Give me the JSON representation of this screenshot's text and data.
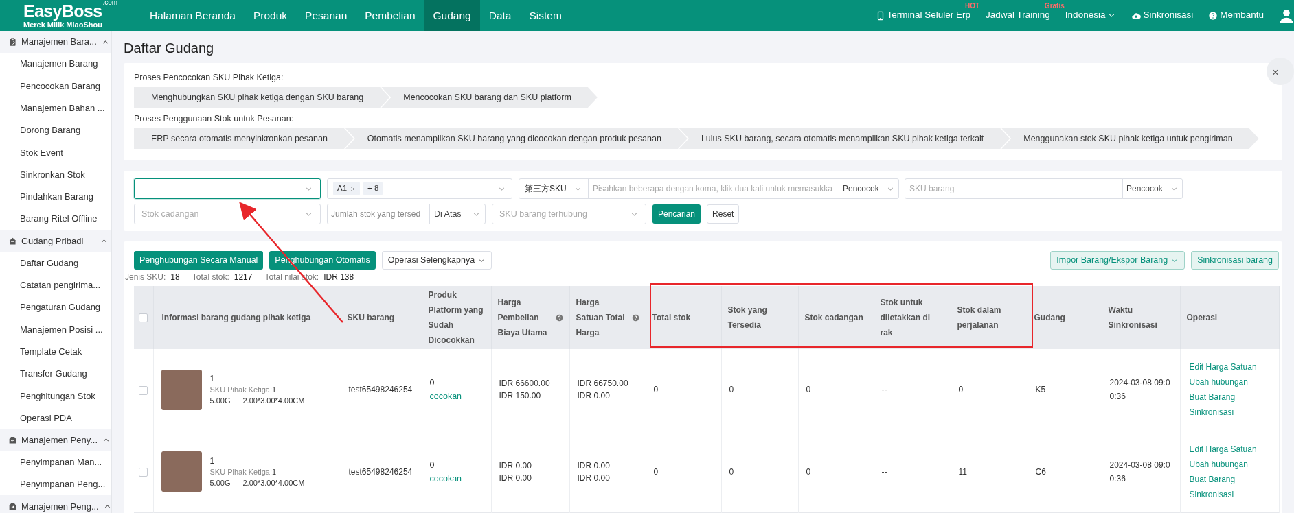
{
  "header": {
    "logo": {
      "title": "EasyBoss",
      "suffix": ".com",
      "subtitle": "Merek Milik MiaoShou"
    },
    "nav": [
      {
        "label": "Halaman Beranda",
        "selected": false
      },
      {
        "label": "Produk",
        "selected": false
      },
      {
        "label": "Pesanan",
        "selected": false
      },
      {
        "label": "Pembelian",
        "selected": false
      },
      {
        "label": "Gudang",
        "selected": true
      },
      {
        "label": "Data",
        "selected": false
      },
      {
        "label": "Sistem",
        "selected": false
      }
    ],
    "tools": [
      {
        "kind": "phone",
        "label": "Terminal Seluler Erp",
        "badge": "HOT"
      },
      {
        "kind": "plain",
        "label": "Jadwal Training",
        "badge": "Gratis"
      },
      {
        "kind": "dropdown",
        "label": "Indonesia"
      },
      {
        "kind": "cloud",
        "label": "Sinkronisasi"
      },
      {
        "kind": "help",
        "label": "Membantu"
      },
      {
        "kind": "user"
      }
    ]
  },
  "sidebar": {
    "groups": [
      {
        "kind": "clipboard",
        "label": "Manajemen Bara...",
        "expanded": true,
        "items": [
          "Manajemen Barang",
          "Pencocokan Barang",
          "Manajemen Bahan ...",
          "Dorong Barang",
          "Stok Event",
          "Sinkronkan Stok",
          "Pindahkan Barang",
          "Barang Ritel Offline"
        ]
      },
      {
        "kind": "house",
        "label": "Gudang Pribadi",
        "expanded": true,
        "items": [
          "Daftar Gudang",
          "Catatan pengirima...",
          "Pengaturan Gudang",
          "Manajemen Posisi ...",
          "Template Cetak",
          "Transfer Gudang",
          "Penghitungan Stok",
          "Operasi PDA"
        ]
      },
      {
        "kind": "inbox",
        "label": "Manajemen Peny...",
        "expanded": true,
        "items": [
          "Penyimpanan Man...",
          "Penyimpanan Peng..."
        ]
      },
      {
        "kind": "outbox",
        "label": "Manajemen Peng...",
        "expanded": true
      }
    ]
  },
  "page_title": "Daftar Gudang",
  "process": {
    "close": "×",
    "sections": [
      {
        "title": "Proses Pencocokan SKU Pihak Ketiga:",
        "steps": [
          "Menghubungkan SKU pihak ketiga dengan SKU barang",
          "Mencocokan SKU barang dan SKU platform"
        ]
      },
      {
        "title": "Proses Penggunaan Stok untuk Pesanan:",
        "steps": [
          "ERP secara otomatis menyinkronkan pesanan",
          "Otomatis menampilkan SKU barang yang dicocokan dengan produk pesanan",
          "Lulus SKU barang, secara otomatis menampilkan SKU pihak ketiga terkait",
          "Menggunakan stok SKU pihak ketiga untuk pengiriman"
        ]
      }
    ]
  },
  "filters": [
    [
      {
        "kind": "select",
        "focused": true
      },
      {
        "kind": "tags",
        "tags": [
          "A1",
          "+ 8"
        ]
      },
      {
        "kind": "combo",
        "type": "第三方SKU",
        "placeholder": "Pisahkan beberapa dengan koma, klik dua kali untuk memasukka",
        "mode": "Pencocok"
      },
      {
        "kind": "combo2",
        "placeholder": "SKU barang",
        "mode": "Pencocok"
      }
    ],
    [
      {
        "kind": "select",
        "placeholder": "Stok cadangan",
        "focused": false
      },
      {
        "kind": "range",
        "placeholder": "Jumlah stok yang tersed",
        "mode": "Di Atas"
      },
      {
        "kind": "select",
        "placeholder": "SKU barang terhubung",
        "focused": false
      },
      {
        "kind": "primary",
        "label": "Pencarian"
      },
      {
        "kind": "plain",
        "label": "Reset"
      }
    ]
  ],
  "toolbar": {
    "left": [
      {
        "kind": "primary",
        "label": "Penghubungan Secara Manual"
      },
      {
        "kind": "primary",
        "label": "Penghubungan Otomatis"
      },
      {
        "kind": "dropdown",
        "label": "Operasi Selengkapnya"
      }
    ],
    "right": [
      {
        "kind": "light-dropdown",
        "label": "Impor Barang/Ekspor Barang"
      },
      {
        "kind": "light",
        "label": "Sinkronisasi barang"
      }
    ]
  },
  "summary": [
    {
      "label": "Jenis SKU:",
      "value": "18"
    },
    {
      "label": "Total stok:",
      "value": "1217"
    },
    {
      "label": "Total nilai stok:",
      "value": "IDR 138"
    }
  ],
  "table": {
    "all_checked": false,
    "columns": [
      {
        "label": "Informasi barang gudang pihak ketiga"
      },
      {
        "label": "SKU barang"
      },
      {
        "label": "Produk Platform yang Sudah Dicocokkan"
      },
      {
        "label": "Harga Pembelian Biaya Utama",
        "help": true
      },
      {
        "label": "Harga Satuan Total Harga",
        "help": true
      },
      {
        "label": "Total stok"
      },
      {
        "label": "Stok yang Tersedia"
      },
      {
        "label": "Stok cadangan"
      },
      {
        "label": "Stok untuk diletakkan di rak"
      },
      {
        "label": "Stok dalam perjalanan"
      },
      {
        "label": "Gudang"
      },
      {
        "label": "Waktu Sinkronisasi"
      },
      {
        "label": "Operasi"
      }
    ],
    "rows": [
      {
        "selected": false,
        "name": "1",
        "third_party_label": "SKU Pihak Ketiga:",
        "third_party_sku": "1",
        "weight": "5.00G",
        "size": "2.00*3.00*4.00CM",
        "sku": "test65498246254",
        "matched": "0",
        "match_link": "cocokan",
        "purchase": [
          "IDR 66600.00",
          "IDR 150.00"
        ],
        "unit": [
          "IDR 66750.00",
          "IDR 0.00"
        ],
        "total": "0",
        "available": "0",
        "reserved": "0",
        "shelf": "--",
        "transit": "0",
        "warehouse": "K5",
        "synced": "2024-03-08 09:00:36",
        "actions": [
          "Edit Harga Satuan",
          "Ubah hubungan",
          "Buat Barang",
          "Sinkronisasi"
        ]
      },
      {
        "selected": false,
        "name": "1",
        "third_party_label": "SKU Pihak Ketiga:",
        "third_party_sku": "1",
        "weight": "5.00G",
        "size": "2.00*3.00*4.00CM",
        "sku": "test65498246254",
        "matched": "0",
        "match_link": "cocokan",
        "purchase": [
          "IDR 0.00",
          "IDR 0.00"
        ],
        "unit": [
          "IDR 0.00",
          "IDR 0.00"
        ],
        "total": "0",
        "available": "0",
        "reserved": "0",
        "shelf": "--",
        "transit": "11",
        "warehouse": "C6",
        "synced": "2024-03-08 09:00:36",
        "actions": [
          "Edit Harga Satuan",
          "Ubah hubungan",
          "Buat Barang",
          "Sinkronisasi"
        ]
      }
    ]
  }
}
